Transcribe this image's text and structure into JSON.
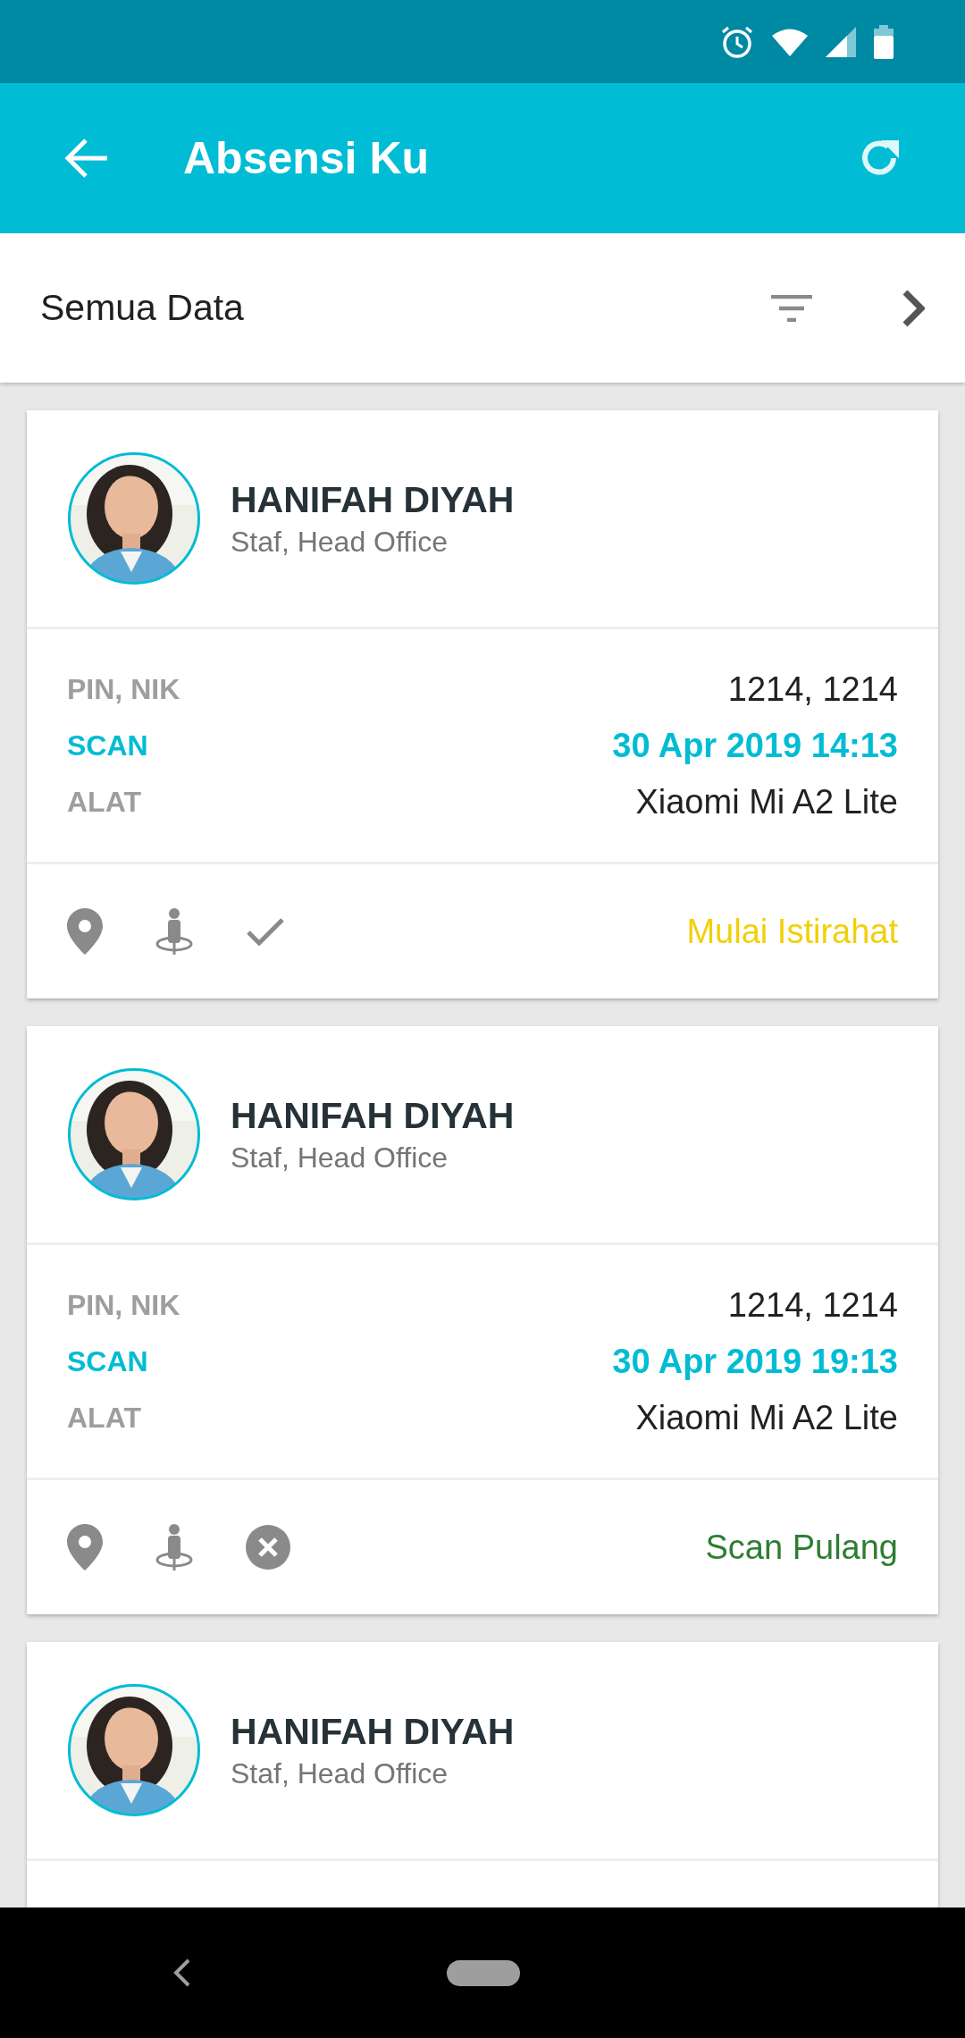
{
  "app_bar": {
    "title": "Absensi Ku"
  },
  "filter_bar": {
    "label": "Semua Data"
  },
  "cards": [
    {
      "name": "HANIFAH DIYAH",
      "subtitle": "Staf, Head Office",
      "details": [
        {
          "kind": "plain",
          "label": "PIN, NIK",
          "value": "1214, 1214"
        },
        {
          "kind": "accent",
          "label": "SCAN",
          "value": "30 Apr 2019 14:13"
        },
        {
          "kind": "plain",
          "label": "ALAT",
          "value": "Xiaomi Mi A2 Lite"
        }
      ],
      "footer": {
        "kind": "check",
        "status": "Mulai Istirahat",
        "color": "#f2cf0a"
      }
    },
    {
      "name": "HANIFAH DIYAH",
      "subtitle": "Staf, Head Office",
      "details": [
        {
          "kind": "plain",
          "label": "PIN, NIK",
          "value": "1214, 1214"
        },
        {
          "kind": "accent",
          "label": "SCAN",
          "value": "30 Apr 2019 19:13"
        },
        {
          "kind": "plain",
          "label": "ALAT",
          "value": "Xiaomi Mi A2 Lite"
        }
      ],
      "footer": {
        "kind": "cancel",
        "status": "Scan Pulang",
        "color": "#2e7d32"
      }
    },
    {
      "name": "HANIFAH DIYAH",
      "subtitle": "Staf, Head Office"
    }
  ]
}
